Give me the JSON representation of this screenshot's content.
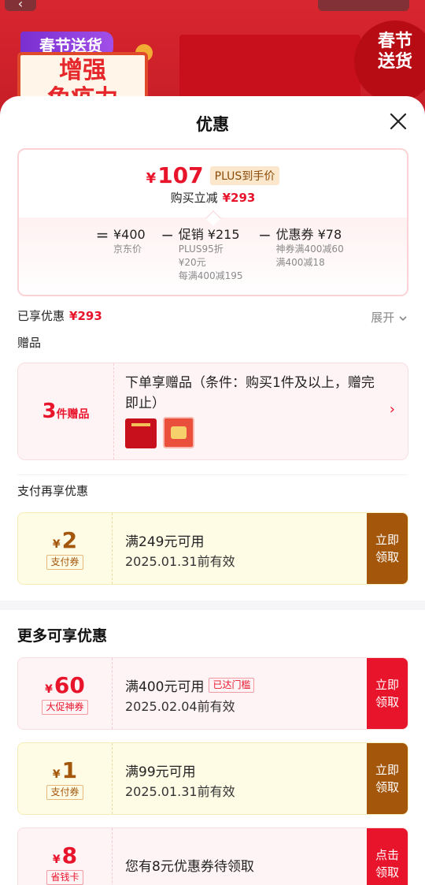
{
  "banner": {
    "back_icon": "arrow-left",
    "tag": "春节送货",
    "headline": "增强\n免疫力",
    "circle_text": "春节\n送货"
  },
  "sheet": {
    "title": "优惠",
    "close_icon": "close-x"
  },
  "price": {
    "currency": "¥",
    "final": "107",
    "plus_tag": "PLUS到手价",
    "reduce_label": "购买立减",
    "reduce_amount": "¥293",
    "breakdown": {
      "eq": "=",
      "minus": "−",
      "jd": {
        "title": "¥400",
        "sub": "京东价"
      },
      "promo": {
        "title": "促销 ¥215",
        "subs": [
          "PLUS95折",
          "¥20元",
          "每满400减195"
        ]
      },
      "coupon": {
        "title": "优惠券 ¥78",
        "subs": [
          "神券满400减60",
          "满400减18"
        ]
      }
    }
  },
  "enjoyed": {
    "label": "已享优惠",
    "amount": "¥293",
    "expand": "展开"
  },
  "gift": {
    "section_label": "赠品",
    "count": "3",
    "count_unit": "件赠品",
    "desc": "下单享赠品（条件：购买1件及以上，赠完即止）",
    "chevron": "›"
  },
  "pay_section": {
    "label": "支付再享优惠"
  },
  "more_section": {
    "title": "更多可享优惠"
  },
  "coupons": [
    {
      "symbol": "¥",
      "value": "2",
      "kind": "支付券",
      "cond": "满249元可用",
      "exp": "2025.01.31前有效",
      "btn": "立即领取"
    },
    {
      "symbol": "¥",
      "value": "60",
      "kind": "大促神券",
      "cond": "满400元可用",
      "badge": "已达门槛",
      "exp": "2025.02.04前有效",
      "btn": "立即领取"
    },
    {
      "symbol": "¥",
      "value": "1",
      "kind": "支付券",
      "cond": "满99元可用",
      "exp": "2025.01.31前有效",
      "btn": "立即领取"
    },
    {
      "symbol": "¥",
      "value": "8",
      "kind": "省钱卡",
      "cond": "您有8元优惠券待领取",
      "btn": "点击领取"
    }
  ]
}
